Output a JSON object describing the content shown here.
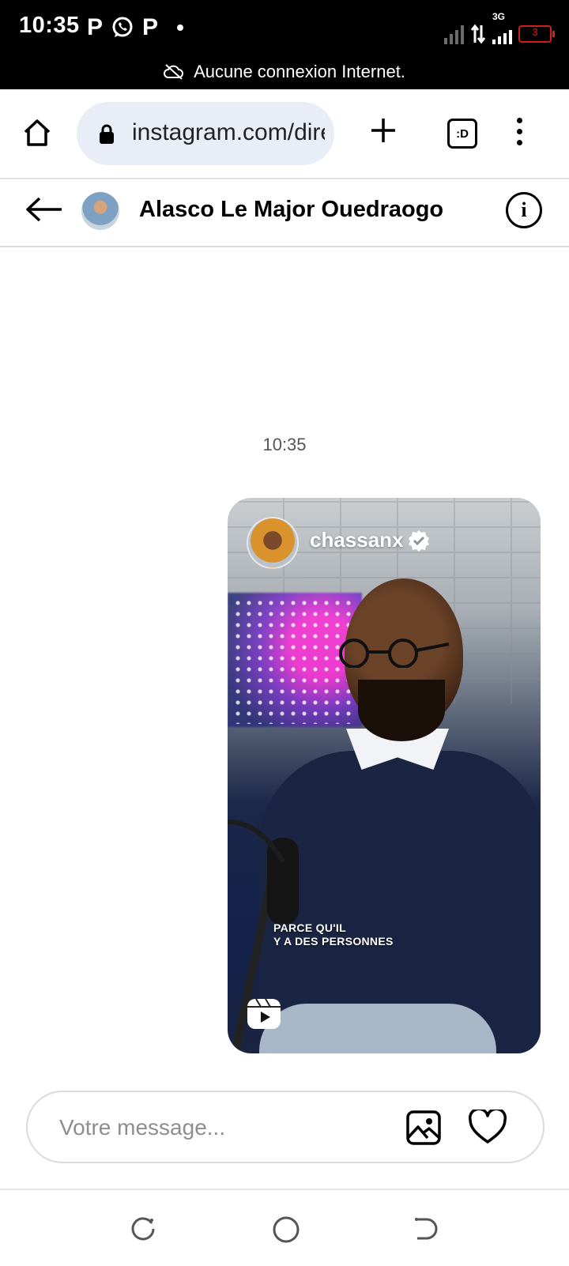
{
  "status_bar": {
    "time": "10:35",
    "notification_icons": [
      "p-app-icon",
      "whatsapp-icon",
      "p-app-icon",
      "dot"
    ],
    "p_glyph": "P",
    "network_type": "3G",
    "battery_level": "3",
    "offline_message": "Aucune connexion Internet."
  },
  "browser": {
    "url": "instagram.com/direct/t/",
    "tabs_label": ":D"
  },
  "chat": {
    "contact_name": "Alasco Le Major Ouedraogo",
    "message_time": "10:35",
    "reel": {
      "username": "chassanx",
      "caption_line1": "PARCE QU'IL",
      "caption_line2": "Y A DES PERSONNES"
    }
  },
  "composer": {
    "placeholder": "Votre message..."
  },
  "colors": {
    "status_bar_bg": "#000000",
    "url_box_bg": "#e9edf5",
    "battery_low": "#d01e1e"
  }
}
